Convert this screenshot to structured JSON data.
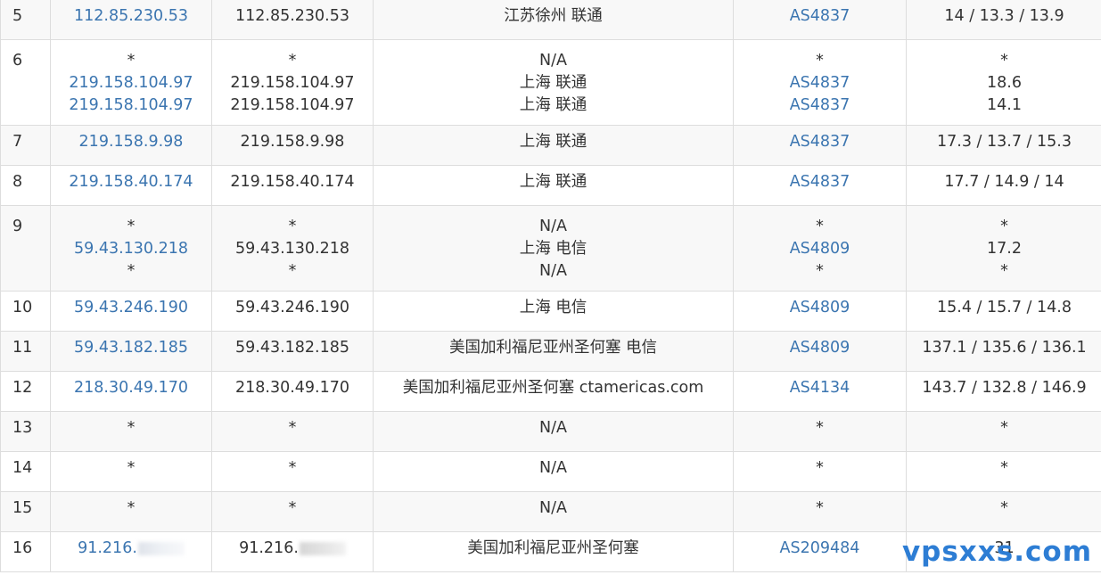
{
  "rows": [
    {
      "hop": "5",
      "ip": [
        "112.85.230.53"
      ],
      "host": [
        "112.85.230.53"
      ],
      "loc": [
        "江苏徐州 联通"
      ],
      "asn": [
        "AS4837"
      ],
      "time": [
        "14 / 13.3 / 13.9"
      ]
    },
    {
      "hop": "6",
      "ip": [
        "*",
        "219.158.104.97",
        "219.158.104.97"
      ],
      "host": [
        "*",
        "219.158.104.97",
        "219.158.104.97"
      ],
      "loc": [
        "N/A",
        "上海 联通",
        "上海 联通"
      ],
      "asn": [
        "*",
        "AS4837",
        "AS4837"
      ],
      "time": [
        "*",
        "18.6",
        "14.1"
      ]
    },
    {
      "hop": "7",
      "ip": [
        "219.158.9.98"
      ],
      "host": [
        "219.158.9.98"
      ],
      "loc": [
        "上海 联通"
      ],
      "asn": [
        "AS4837"
      ],
      "time": [
        "17.3 / 13.7 / 15.3"
      ]
    },
    {
      "hop": "8",
      "ip": [
        "219.158.40.174"
      ],
      "host": [
        "219.158.40.174"
      ],
      "loc": [
        "上海 联通"
      ],
      "asn": [
        "AS4837"
      ],
      "time": [
        "17.7 / 14.9 / 14"
      ]
    },
    {
      "hop": "9",
      "ip": [
        "*",
        "59.43.130.218",
        "*"
      ],
      "host": [
        "*",
        "59.43.130.218",
        "*"
      ],
      "loc": [
        "N/A",
        "上海 电信",
        "N/A"
      ],
      "asn": [
        "*",
        "AS4809",
        "*"
      ],
      "time": [
        "*",
        "17.2",
        "*"
      ]
    },
    {
      "hop": "10",
      "ip": [
        "59.43.246.190"
      ],
      "host": [
        "59.43.246.190"
      ],
      "loc": [
        "上海 电信"
      ],
      "asn": [
        "AS4809"
      ],
      "time": [
        "15.4 / 15.7 / 14.8"
      ]
    },
    {
      "hop": "11",
      "ip": [
        "59.43.182.185"
      ],
      "host": [
        "59.43.182.185"
      ],
      "loc": [
        "美国加利福尼亚州圣何塞 电信"
      ],
      "asn": [
        "AS4809"
      ],
      "time": [
        "137.1 / 135.6 / 136.1"
      ]
    },
    {
      "hop": "12",
      "ip": [
        "218.30.49.170"
      ],
      "host": [
        "218.30.49.170"
      ],
      "loc": [
        "美国加利福尼亚州圣何塞 ctamericas.com"
      ],
      "asn": [
        "AS4134"
      ],
      "time": [
        "143.7 / 132.8 / 146.9"
      ]
    },
    {
      "hop": "13",
      "ip": [
        "*"
      ],
      "host": [
        "*"
      ],
      "loc": [
        "N/A"
      ],
      "asn": [
        "*"
      ],
      "time": [
        "*"
      ]
    },
    {
      "hop": "14",
      "ip": [
        "*"
      ],
      "host": [
        "*"
      ],
      "loc": [
        "N/A"
      ],
      "asn": [
        "*"
      ],
      "time": [
        "*"
      ]
    },
    {
      "hop": "15",
      "ip": [
        "*"
      ],
      "host": [
        "*"
      ],
      "loc": [
        "N/A"
      ],
      "asn": [
        "*"
      ],
      "time": [
        "*"
      ]
    },
    {
      "hop": "16",
      "ip": [
        "91.216."
      ],
      "host": [
        "91.216."
      ],
      "loc": [
        "美国加利福尼亚州圣何塞"
      ],
      "asn": [
        "AS209484"
      ],
      "time": [
        "31"
      ],
      "redacted": true
    }
  ],
  "watermark": "vpsxxs.com",
  "colors": {
    "link": "#3b75b0",
    "border": "#dddddd",
    "stripe": "#f8f8f8",
    "watermark": "#2d7dd4"
  }
}
